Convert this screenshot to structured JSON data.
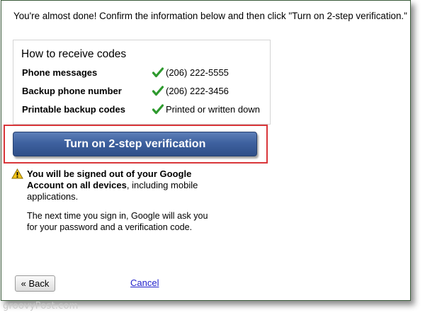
{
  "intro_text": "You're almost done! Confirm the information below and then click \"Turn on 2-step verification.\"",
  "codes_section": {
    "title": "How to receive codes",
    "rows": [
      {
        "label": "Phone messages",
        "value": "(206) 222-5555"
      },
      {
        "label": "Backup phone number",
        "value": "(206) 222-3456"
      },
      {
        "label": "Printable backup codes",
        "value": "Printed or written down"
      }
    ],
    "check_color": "#2e9a2e"
  },
  "primary_button": {
    "label": "Turn on 2-step verification",
    "color": "#3e619f"
  },
  "highlight_color": "#d9363a",
  "warning": {
    "bold_text": "You will be signed out of your Google Account on all devices",
    "rest_text": ", including mobile applications.",
    "icon": "warning-triangle-icon"
  },
  "next_signin_text": "The next time you sign in, Google will ask you for your password and a verification code.",
  "back_button_label": "« Back",
  "cancel_label": "Cancel",
  "watermark": "groovyPost.com"
}
